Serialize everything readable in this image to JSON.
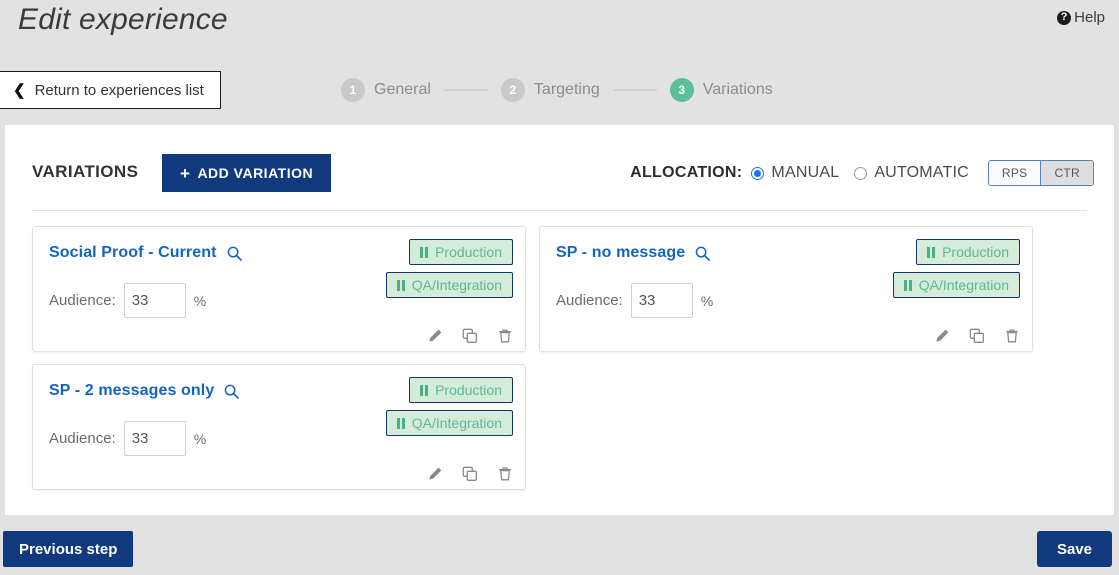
{
  "header": {
    "title": "Edit experience",
    "help_label": "Help",
    "help_icon": "question-circle-icon",
    "return_label": "Return to experiences list",
    "return_icon": "chevron-left-icon"
  },
  "stepper": {
    "steps": [
      {
        "num": "1",
        "label": "General",
        "active": false
      },
      {
        "num": "2",
        "label": "Targeting",
        "active": false
      },
      {
        "num": "3",
        "label": "Variations",
        "active": true
      }
    ],
    "active_color": "#5cbf9a",
    "inactive_color": "#c9c9c9"
  },
  "toolbar": {
    "variations_label": "VARIATIONS",
    "add_variation_label": "ADD VARIATION",
    "add_variation_icon": "plus-icon",
    "allocation_label": "ALLOCATION:",
    "allocation_options": [
      {
        "label": "MANUAL",
        "selected": true
      },
      {
        "label": "AUTOMATIC",
        "selected": false
      }
    ],
    "metric_toggle": [
      {
        "label": "RPS",
        "active": false
      },
      {
        "label": "CTR",
        "active": true
      }
    ],
    "primary_color": "#103a7d",
    "radio_color": "#1a73e8"
  },
  "variations": [
    {
      "title": "Social Proof - Current",
      "search_icon": "search-icon",
      "audience_label": "Audience:",
      "audience_value": "33",
      "percent_symbol": "%",
      "badges": [
        {
          "label": "Production",
          "icon": "pause-icon"
        },
        {
          "label": "QA/Integration",
          "icon": "pause-icon"
        }
      ],
      "actions": [
        {
          "icon": "pencil-icon"
        },
        {
          "icon": "copy-icon"
        },
        {
          "icon": "trash-icon"
        }
      ]
    },
    {
      "title": "SP - no message",
      "search_icon": "search-icon",
      "audience_label": "Audience:",
      "audience_value": "33",
      "percent_symbol": "%",
      "badges": [
        {
          "label": "Production",
          "icon": "pause-icon"
        },
        {
          "label": "QA/Integration",
          "icon": "pause-icon"
        }
      ],
      "actions": [
        {
          "icon": "pencil-icon"
        },
        {
          "icon": "copy-icon"
        },
        {
          "icon": "trash-icon"
        }
      ]
    },
    {
      "title": "SP - 2 messages only",
      "search_icon": "search-icon",
      "audience_label": "Audience:",
      "audience_value": "33",
      "percent_symbol": "%",
      "badges": [
        {
          "label": "Production",
          "icon": "pause-icon"
        },
        {
          "label": "QA/Integration",
          "icon": "pause-icon"
        }
      ],
      "actions": [
        {
          "icon": "pencil-icon"
        },
        {
          "icon": "copy-icon"
        },
        {
          "icon": "trash-icon"
        }
      ]
    }
  ],
  "footer": {
    "previous_label": "Previous step",
    "save_label": "Save"
  },
  "colors": {
    "page_background": "#e2e2e2",
    "panel_background": "#ffffff",
    "badge_background": "#d5ecd9",
    "badge_border": "#14356e",
    "badge_text": "#5ab89a",
    "card_title": "#1565c0"
  }
}
